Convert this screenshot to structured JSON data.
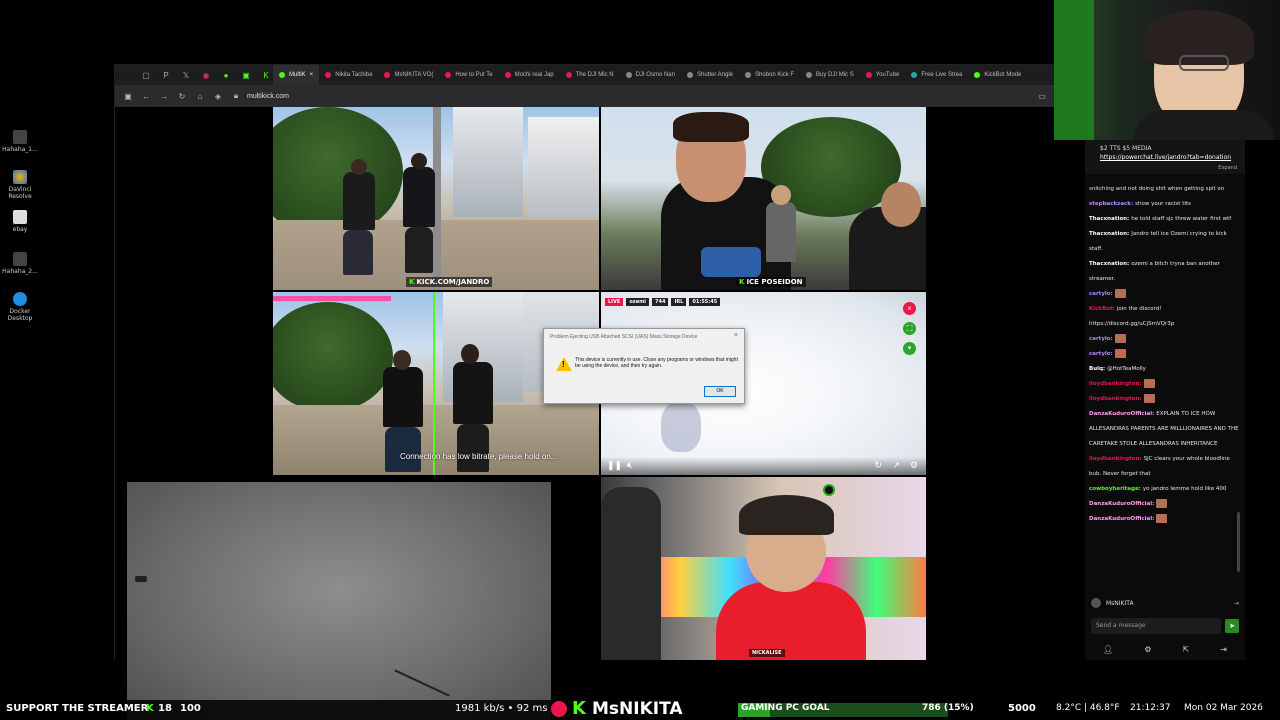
{
  "desktop": {
    "icons": [
      {
        "label": "Hahaha_1..."
      },
      {
        "label": "DaVinci Resolve"
      },
      {
        "label": "ebay"
      },
      {
        "label": "Hahaha_2..."
      },
      {
        "label": "Docker Desktop"
      }
    ]
  },
  "browser": {
    "tabs": [
      {
        "label": "MultiK",
        "color": "#53fc18",
        "active": true
      },
      {
        "label": "Nikita Tachiba",
        "color": "#e9174b"
      },
      {
        "label": "MsNIKITA VO(",
        "color": "#e9174b"
      },
      {
        "label": "How to Put Te",
        "color": "#e9174b"
      },
      {
        "label": "Mochi real Jap",
        "color": "#e9174b"
      },
      {
        "label": "The DJI Mic N",
        "color": "#e9174b"
      },
      {
        "label": "DJI Osmo Nan",
        "color": "#888888"
      },
      {
        "label": "Shutter Angle",
        "color": "#888888"
      },
      {
        "label": "Shobon Kick F",
        "color": "#888888"
      },
      {
        "label": "Buy DJI Mic S",
        "color": "#888888"
      },
      {
        "label": "YouTube",
        "color": "#e9174b"
      },
      {
        "label": "Free Live Strea",
        "color": "#2aa"
      },
      {
        "label": "KickBot Mode",
        "color": "#53fc18"
      }
    ],
    "url": "multikick.com"
  },
  "tiles": {
    "t1_tag": "KICK.COM/JANDRO",
    "t2_tag": "ICE POSEIDON",
    "t3_notice": "Connection has low bitrate, please hold on...",
    "t4_live": "LIVE",
    "t4_user": "ozemi",
    "t4_viewers": "744",
    "t4_mode": "IRL",
    "t4_time": "01:55:45",
    "t6_tag": "NICKALISE"
  },
  "dialog": {
    "title": "Problem Ejecting USB Attached SCSI (UAS) Mass Storage Device",
    "message": "This device is currently in use. Close any programs or windows that might be using the device, and then try again.",
    "ok": "OK"
  },
  "chat": {
    "pinned_text": "$2 TTS $5 MEDIA",
    "pinned_link": "https://powerchat.live/jandro?tab=donation",
    "expand": "Expand",
    "messages": [
      {
        "user": "",
        "color": "#ffffff",
        "text": "snitching and not doing shit when getting spit on",
        "emote": false
      },
      {
        "user": "stepbackzack:",
        "color": "#b388ff",
        "text": "show your racist tits",
        "emote": false
      },
      {
        "user": "Thacxnation:",
        "color": "#ffffff",
        "text": "he told staff sjc threw water first wtf",
        "emote": false
      },
      {
        "user": "Thacxnation:",
        "color": "#ffffff",
        "text": "Jandro tell ice Ozemi crying to kick staff.",
        "emote": false
      },
      {
        "user": "Thacxnation:",
        "color": "#ffffff",
        "text": "ozemi a bitch tryna ban another streamer.",
        "emote": false
      },
      {
        "user": "cartylo:",
        "color": "#b388ff",
        "text": "",
        "emote": true
      },
      {
        "user": "KickBot:",
        "color": "#e9174b",
        "text": "join the discord! https://discord.gg/uCjSmVQr3p",
        "emote": false
      },
      {
        "user": "cartylo:",
        "color": "#b388ff",
        "text": "",
        "emote": true
      },
      {
        "user": "cartylo:",
        "color": "#b388ff",
        "text": "",
        "emote": true
      },
      {
        "user": "Bulq:",
        "color": "#ffffff",
        "text": "@HotTeaMolly",
        "emote": false
      },
      {
        "user": "lloydbankington:",
        "color": "#e9174b",
        "text": "",
        "emote": true
      },
      {
        "user": "lloydbankington:",
        "color": "#e9174b",
        "text": "",
        "emote": true
      },
      {
        "user": "DanzaKuduroOfficial:",
        "color": "#ff9ff3",
        "text": "EXPLAIN TO ICE HOW ALLESANDRAS PARENTS ARE MILLLIONAIRES AND THE CARETAKE STOLE ALLESANDRAS INHERITANCE",
        "emote": false
      },
      {
        "user": "lloydbankington:",
        "color": "#e9174b",
        "text": "SJC clears your whole bloodline bub. Never forget that",
        "emote": false
      },
      {
        "user": "cowboyheritage:",
        "color": "#53fc18",
        "text": "yo jandro lemme hold like 400",
        "emote": false
      },
      {
        "user": "DanzaKuduroOfficial:",
        "color": "#ff9ff3",
        "text": "",
        "emote": true
      },
      {
        "user": "DanzaKuduroOfficial:",
        "color": "#ff9ff3",
        "text": "",
        "emote": true
      }
    ],
    "self_name": "MsNIKITA",
    "input_placeholder": "Send a message"
  },
  "bottom": {
    "support": "SUPPORT THE STREAMER",
    "subs": "18",
    "subs_goal": "100",
    "bitrate": "1981 kb/s • 92 ms",
    "brand": "MsNIKITA",
    "goal_label": "GAMING PC GOAL",
    "goal_value": "786 (15%)",
    "goal_fraction": 0.15,
    "goal_target": "5000",
    "temp": "8.2°C | 46.8°F",
    "time": "21:12:37",
    "date": "Mon 02 Mar 2026"
  },
  "colors": {
    "kick_green": "#53fc18",
    "accent_red": "#e9174b"
  }
}
